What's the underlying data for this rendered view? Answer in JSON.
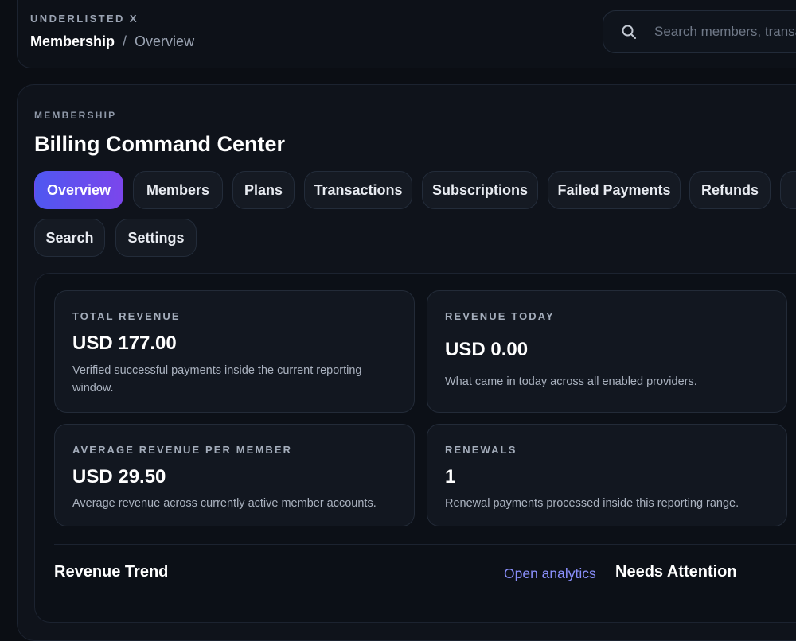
{
  "header": {
    "brand": "UNDERLISTED X",
    "breadcrumb": {
      "section": "Membership",
      "separator": "/",
      "current": "Overview"
    },
    "search": {
      "placeholder": "Search members, transactions"
    }
  },
  "page": {
    "eyebrow": "MEMBERSHIP",
    "title": "Billing Command Center"
  },
  "tabs": [
    {
      "label": "Overview",
      "active": true
    },
    {
      "label": "Members"
    },
    {
      "label": "Plans"
    },
    {
      "label": "Transactions"
    },
    {
      "label": "Subscriptions"
    },
    {
      "label": "Failed Payments"
    },
    {
      "label": "Refunds"
    },
    {
      "label": "Search"
    },
    {
      "label": "Settings"
    }
  ],
  "stats": [
    {
      "label": "TOTAL REVENUE",
      "value": "USD 177.00",
      "description": "Verified successful payments inside the current reporting window."
    },
    {
      "label": "REVENUE TODAY",
      "value": "USD 0.00",
      "description": "What came in today across all enabled providers."
    },
    {
      "label": "AVERAGE REVENUE PER MEMBER",
      "value": "USD 29.50",
      "description": "Average revenue across currently active member accounts."
    },
    {
      "label": "RENEWALS",
      "value": "1",
      "description": "Renewal payments processed inside this reporting range."
    }
  ],
  "sections": {
    "revenue_trend": {
      "title": "Revenue Trend",
      "link": "Open analytics"
    },
    "needs_attention": {
      "title": "Needs Attention"
    }
  },
  "colors": {
    "accent_start": "#4f57f0",
    "accent_end": "#7b46ec",
    "link": "#8a8ffb"
  }
}
